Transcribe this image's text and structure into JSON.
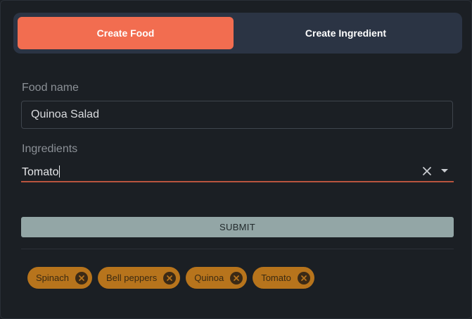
{
  "tabs": [
    {
      "label": "Create Food",
      "active": true
    },
    {
      "label": "Create Ingredient",
      "active": false
    }
  ],
  "form": {
    "food_name_label": "Food name",
    "food_name_value": "Quinoa Salad",
    "ingredients_label": "Ingredients",
    "ingredients_input_value": "Tomato",
    "submit_label": "SUBMIT"
  },
  "selected_ingredients": [
    {
      "label": "Spinach"
    },
    {
      "label": "Bell peppers"
    },
    {
      "label": "Quinoa"
    },
    {
      "label": "Tomato"
    }
  ],
  "icons": {
    "clear": "close-icon",
    "dropdown": "arrow-drop-down-icon",
    "chip_delete": "cancel-circle-icon"
  },
  "colors": {
    "accent": "#f26d50",
    "chip": "#b7741c",
    "submit": "#93a6a6",
    "underline": "#b9543e"
  }
}
